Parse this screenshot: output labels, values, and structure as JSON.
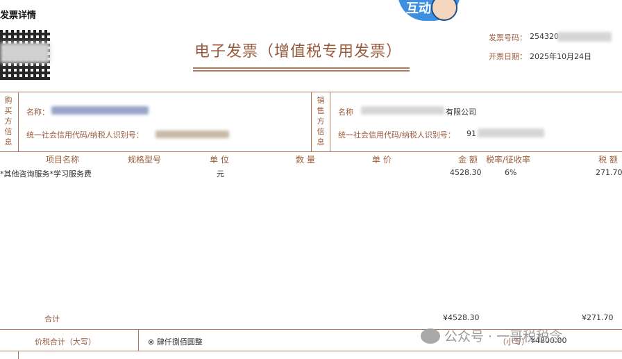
{
  "page_title": "发票详情",
  "invoice": {
    "title": "电子发票（增值税专用发票）",
    "number_label": "发票号码：",
    "number_value": "254320",
    "date_label": "开票日期：",
    "date_value": "2025年10月24日"
  },
  "buyer": {
    "side_label": [
      "购",
      "买",
      "方",
      "信",
      "息"
    ],
    "name_label": "名称：",
    "tax_label": "统一社会信用代码/纳税人识别号："
  },
  "seller": {
    "side_label": [
      "销",
      "售",
      "方",
      "信",
      "息"
    ],
    "name_label": "名称",
    "name_suffix": "有限公司",
    "tax_label": "统一社会信用代码/纳税人识别号：",
    "tax_value_prefix": "91"
  },
  "columns": {
    "item_name": "项目名称",
    "spec": "规格型号",
    "unit": "单 位",
    "qty": "数 量",
    "price": "单 价",
    "amount": "金 额",
    "rate": "税率/征收率",
    "tax": "税 额"
  },
  "row": {
    "item_name": "*其他咨询服务*学习服务费",
    "unit": "元",
    "amount": "4528.30",
    "rate": "6%",
    "tax": "271.70"
  },
  "total": {
    "label": "合计",
    "amount": "¥4528.30",
    "tax": "¥271.70"
  },
  "grand_total": {
    "label": "价税合计（大写）",
    "upper_value": "肆仟捌佰圆整",
    "small_label": "（小写）",
    "small_value": "¥4800.00"
  },
  "watermark": "公众号 · 一哥税税念",
  "badge_text": "互动"
}
